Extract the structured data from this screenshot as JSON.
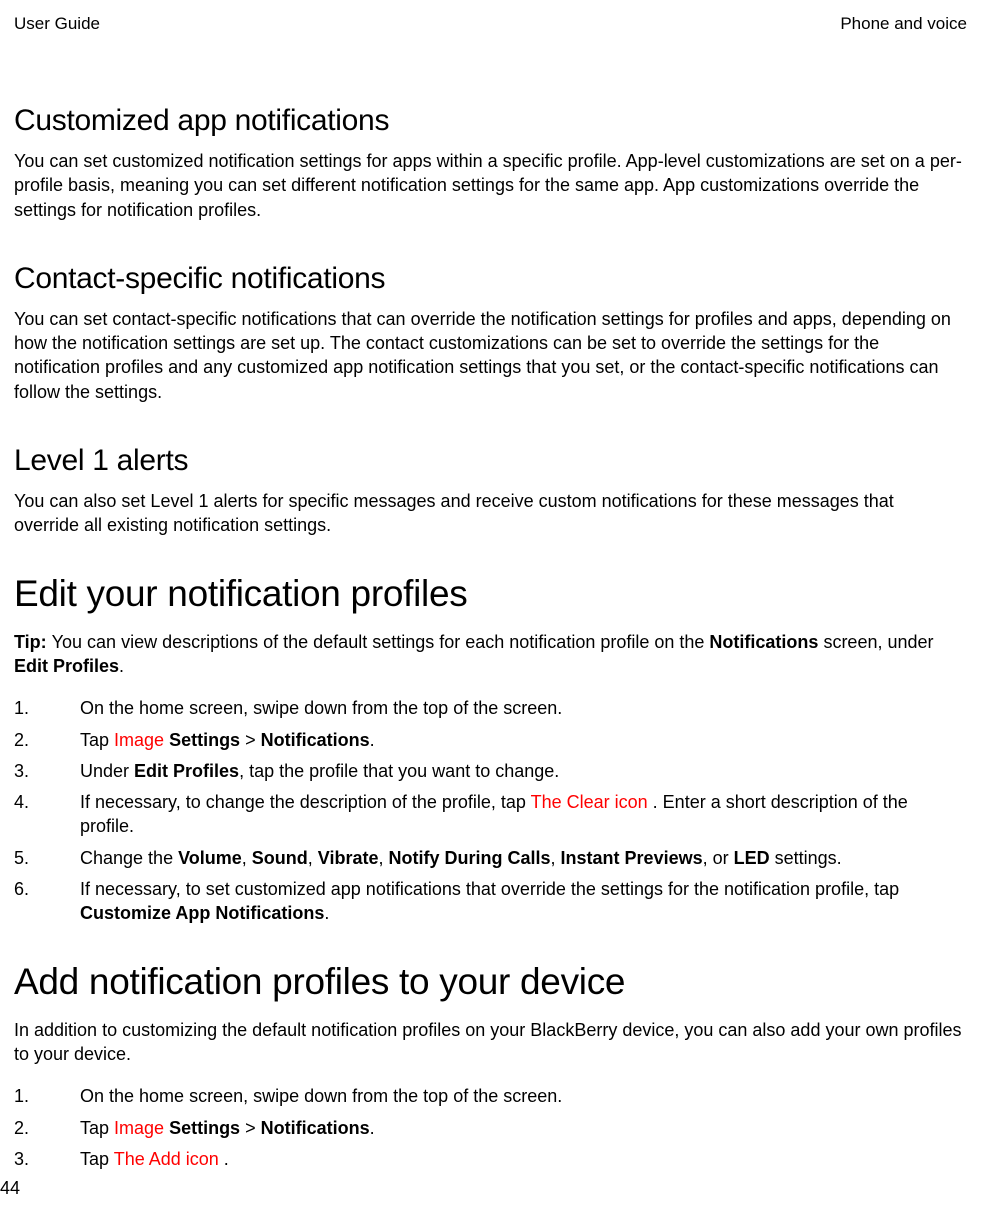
{
  "header": {
    "left": "User Guide",
    "right": "Phone and voice"
  },
  "sections": {
    "customized": {
      "heading": "Customized app notifications",
      "body": "You can set customized notification settings for apps within a specific profile. App-level customizations are set on a per-profile basis, meaning you can set different notification settings for the same app. App customizations override the settings for notification profiles."
    },
    "contact": {
      "heading": "Contact-specific notifications",
      "body": "You can set contact-specific notifications that can override the notification settings for profiles and apps, depending on how the notification settings are set up. The contact customizations can be set to override the settings for the notification profiles and any customized app notification settings that you set, or the contact-specific notifications can follow the settings."
    },
    "level1": {
      "heading": "Level 1 alerts",
      "body": "You can also set Level 1 alerts for specific messages and receive custom notifications for these messages that override all existing notification settings."
    },
    "edit": {
      "heading": "Edit your notification profiles",
      "tip_label": "Tip: ",
      "tip_body_1": "You can view descriptions of the default settings for each notification profile on the ",
      "tip_bold_1": "Notifications",
      "tip_body_2": " screen, under ",
      "tip_bold_2": "Edit Profiles",
      "tip_body_3": ".",
      "steps": {
        "s1": "On the home screen, swipe down from the top of the screen.",
        "s2_a": "Tap ",
        "s2_img": " Image ",
        "s2_b": "Settings",
        "s2_c": " > ",
        "s2_d": "Notifications",
        "s2_e": ".",
        "s3_a": "Under ",
        "s3_b": "Edit Profiles",
        "s3_c": ", tap the profile that you want to change.",
        "s4_a": "If necessary, to change the description of the profile, tap ",
        "s4_img": " The Clear icon ",
        "s4_b": ". Enter a short description of the profile.",
        "s5_a": "Change the ",
        "s5_b": "Volume",
        "s5_c": ", ",
        "s5_d": "Sound",
        "s5_e": ", ",
        "s5_f": "Vibrate",
        "s5_g": ", ",
        "s5_h": "Notify During Calls",
        "s5_i": ", ",
        "s5_j": "Instant Previews",
        "s5_k": ", or ",
        "s5_l": "LED",
        "s5_m": " settings.",
        "s6_a": "If necessary, to set customized app notifications that override the settings for the notification profile, tap ",
        "s6_b": "Customize App Notifications",
        "s6_c": "."
      }
    },
    "add": {
      "heading": "Add notification profiles to your device",
      "intro": "In addition to customizing the default notification profiles on your BlackBerry device, you can also add your own profiles to your device.",
      "steps": {
        "s1": "On the home screen, swipe down from the top of the screen.",
        "s2_a": "Tap ",
        "s2_img": " Image ",
        "s2_b": "Settings",
        "s2_c": " > ",
        "s2_d": "Notifications",
        "s2_e": ".",
        "s3_a": "Tap ",
        "s3_img": " The Add icon ",
        "s3_b": "."
      }
    }
  },
  "nums": {
    "n1": "1.",
    "n2": "2.",
    "n3": "3.",
    "n4": "4.",
    "n5": "5.",
    "n6": "6."
  },
  "page_number": "44"
}
